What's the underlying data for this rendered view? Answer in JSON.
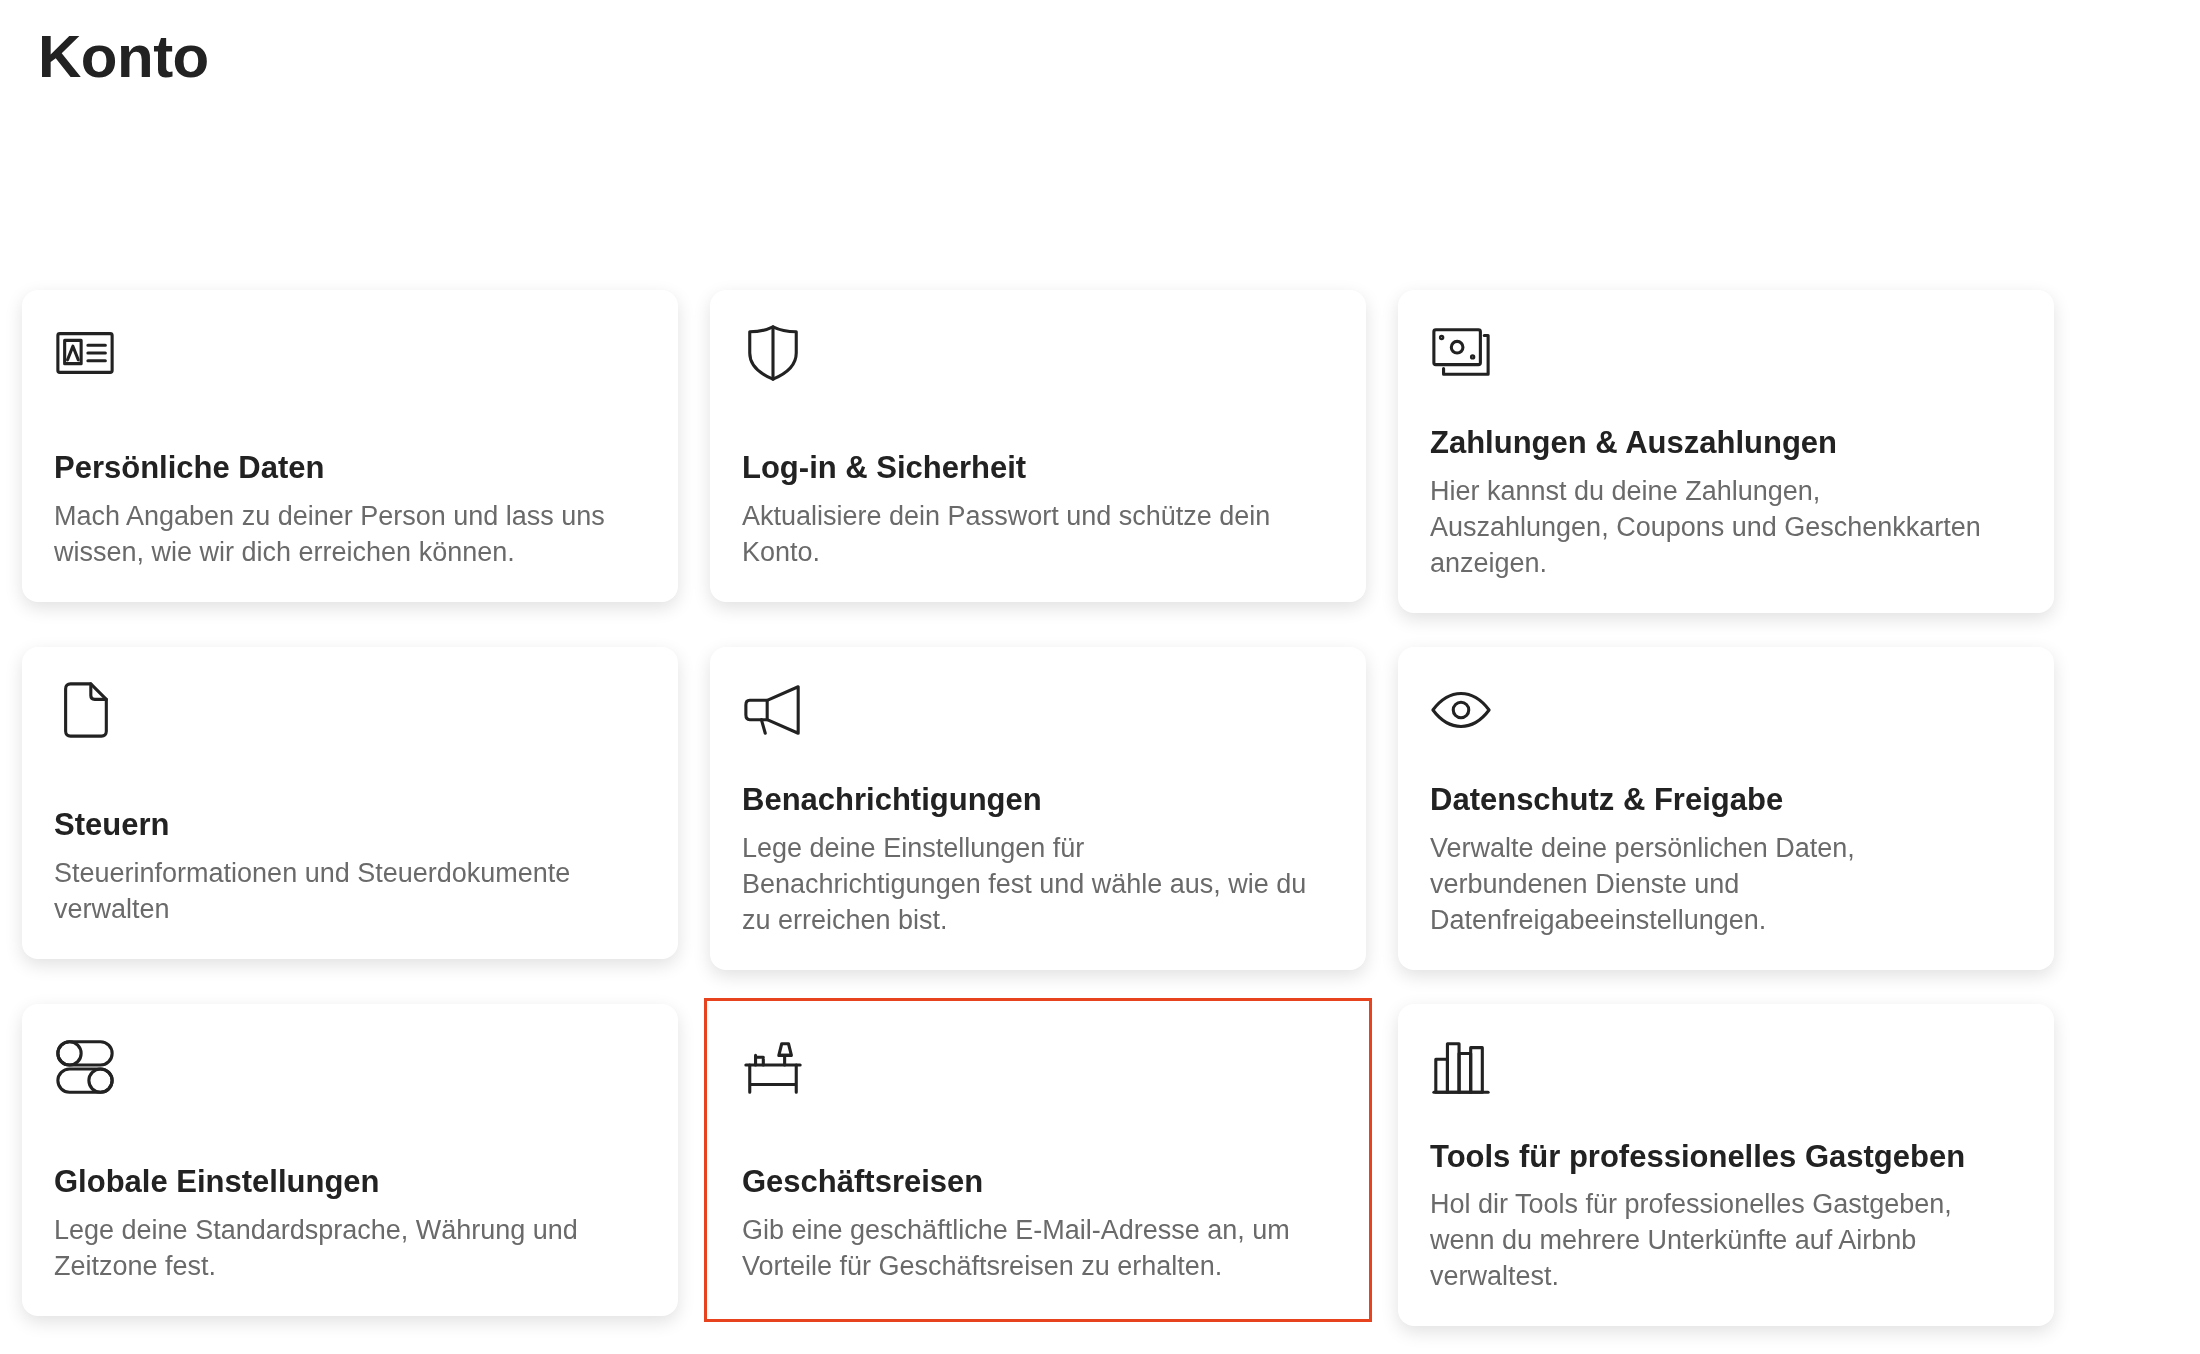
{
  "page": {
    "title": "Konto"
  },
  "cards": [
    {
      "title": "Persönliche Daten",
      "description": "Mach Angaben zu deiner Person und lass uns wissen, wie wir dich erreichen können.",
      "highlighted": false
    },
    {
      "title": "Log-in & Sicherheit",
      "description": "Aktualisiere dein Passwort und schütze dein Konto.",
      "highlighted": false
    },
    {
      "title": "Zahlungen & Auszahlungen",
      "description": "Hier kannst du deine Zahlungen, Auszahlungen, Coupons und Geschenkkarten anzeigen.",
      "highlighted": false
    },
    {
      "title": "Steuern",
      "description": "Steuerinformationen und Steuerdokumente verwalten",
      "highlighted": false
    },
    {
      "title": "Benachrichtigungen",
      "description": "Lege deine Einstellungen für Benachrichtigungen fest und wähle aus, wie du zu erreichen bist.",
      "highlighted": false
    },
    {
      "title": "Datenschutz & Freigabe",
      "description": "Verwalte deine persönlichen Daten, verbundenen Dienste und Datenfreigabeeinstellungen.",
      "highlighted": false
    },
    {
      "title": "Globale Einstellungen",
      "description": "Lege deine Standardsprache, Währung und Zeitzone fest.",
      "highlighted": false
    },
    {
      "title": "Geschäftsreisen",
      "description": "Gib eine geschäftliche E-Mail-Adresse an, um Vorteile für Geschäftsreisen zu erhalten.",
      "highlighted": true
    },
    {
      "title": "Tools für professionelles Gastgeben",
      "description": "Hol dir Tools für professionelles Gastgeben, wenn du mehrere Unterkünfte auf Airbnb verwaltest.",
      "highlighted": false
    }
  ]
}
